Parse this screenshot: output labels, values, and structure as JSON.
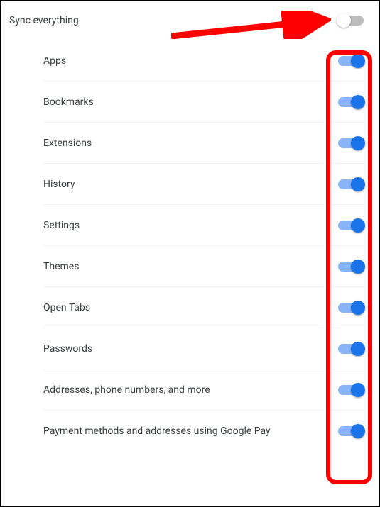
{
  "colors": {
    "accent": "#1a73e8",
    "accent_track": "#8ab4f8",
    "off_track": "#bdbdbd",
    "annotation": "#ff0000"
  },
  "master": {
    "label": "Sync everything",
    "enabled": false
  },
  "items": [
    {
      "label": "Apps",
      "enabled": true
    },
    {
      "label": "Bookmarks",
      "enabled": true
    },
    {
      "label": "Extensions",
      "enabled": true
    },
    {
      "label": "History",
      "enabled": true
    },
    {
      "label": "Settings",
      "enabled": true
    },
    {
      "label": "Themes",
      "enabled": true
    },
    {
      "label": "Open Tabs",
      "enabled": true
    },
    {
      "label": "Passwords",
      "enabled": true
    },
    {
      "label": "Addresses, phone numbers, and more",
      "enabled": true
    },
    {
      "label": "Payment methods and addresses using Google Pay",
      "enabled": true
    }
  ]
}
